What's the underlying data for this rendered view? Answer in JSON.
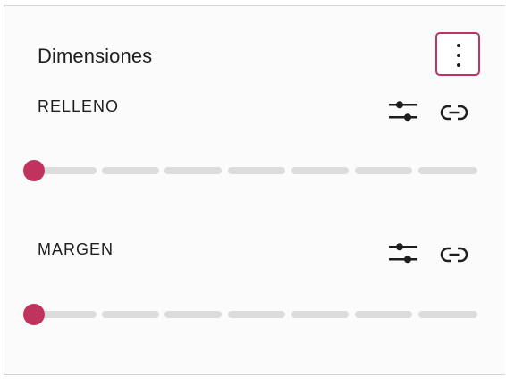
{
  "panel": {
    "title": "Dimensiones",
    "options_icon": "more-vertical-icon",
    "accent_color": "#c0335f"
  },
  "sections": [
    {
      "label": "RELLENO",
      "controls": [
        {
          "name": "custom-sizes-toggle",
          "icon": "sliders-icon"
        },
        {
          "name": "link-sides-toggle",
          "icon": "link-icon"
        }
      ],
      "slider": {
        "value": 0,
        "steps": 7
      }
    },
    {
      "label": "MARGEN",
      "controls": [
        {
          "name": "custom-sizes-toggle",
          "icon": "sliders-icon"
        },
        {
          "name": "link-sides-toggle",
          "icon": "link-icon"
        }
      ],
      "slider": {
        "value": 0,
        "steps": 7
      }
    }
  ]
}
